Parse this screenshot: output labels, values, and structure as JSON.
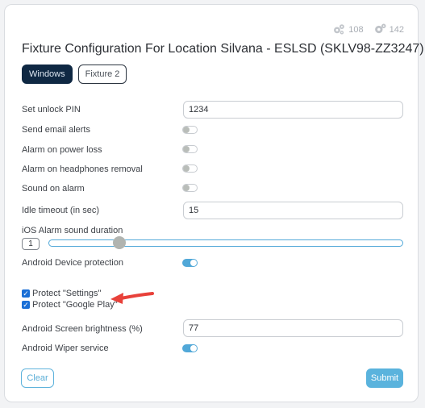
{
  "header": {
    "badges": [
      {
        "icon": "gear-icon",
        "count": "108"
      },
      {
        "icon": "gears-icon",
        "count": "142"
      }
    ],
    "title": "Fixture Configuration For Location Silvana - ESLSD (SKLV98-ZZ3247)"
  },
  "tabs": [
    {
      "label": "Windows",
      "active": true
    },
    {
      "label": "Fixture 2",
      "active": false
    }
  ],
  "settings": {
    "unlock_pin": {
      "label": "Set unlock PIN",
      "value": "1234"
    },
    "send_email_alerts": {
      "label": "Send email alerts",
      "on": false
    },
    "alarm_power_loss": {
      "label": "Alarm on power loss",
      "on": false
    },
    "alarm_headphones": {
      "label": "Alarm on headphones removal",
      "on": false
    },
    "sound_on_alarm": {
      "label": "Sound on alarm",
      "on": false
    },
    "idle_timeout": {
      "label": "Idle timeout (in sec)",
      "value": "15"
    },
    "ios_alarm_duration": {
      "label": "iOS Alarm sound duration",
      "value": "1",
      "slider_fraction": 0.2
    },
    "android_protection": {
      "label": "Android Device protection",
      "on": true
    },
    "protect_settings": {
      "label": "Protect \"Settings\"",
      "checked": true
    },
    "protect_google_play": {
      "label": "Protect \"Google Play\"",
      "checked": true
    },
    "screen_brightness": {
      "label": "Android Screen brightness (%)",
      "value": "77"
    },
    "wiper_service": {
      "label": "Android Wiper service",
      "on": true
    }
  },
  "actions": {
    "clear_label": "Clear",
    "submit_label": "Submit"
  },
  "colors": {
    "accent": "#51a8d8",
    "active_tab": "#0f2843",
    "annotation_arrow": "#e8413a"
  }
}
